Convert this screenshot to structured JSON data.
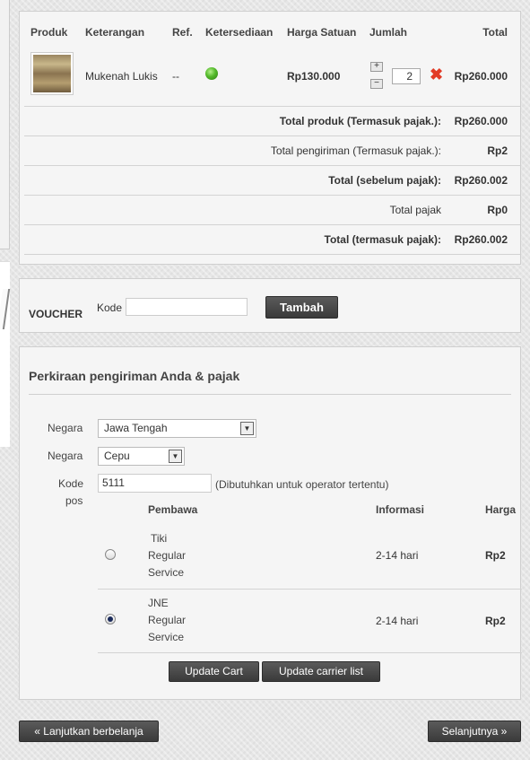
{
  "cart": {
    "headers": {
      "product": "Produk",
      "description": "Keterangan",
      "ref": "Ref.",
      "availability": "Ketersediaan",
      "unit_price": "Harga Satuan",
      "qty": "Jumlah",
      "total": "Total"
    },
    "item": {
      "name": "Mukenah Lukis",
      "ref": "--",
      "unit_price": "Rp130.000",
      "qty_increase": "+",
      "qty_decrease": "−",
      "qty": "2",
      "delete_icon": "✖",
      "total": "Rp260.000"
    },
    "summary": [
      {
        "label": "Total produk (Termasuk pajak.):",
        "value": "Rp260.000"
      },
      {
        "label": "Total pengiriman (Termasuk pajak.):",
        "value": "Rp2"
      },
      {
        "label": "Total (sebelum pajak):",
        "value": "Rp260.002"
      },
      {
        "label": "Total pajak",
        "value": "Rp0"
      },
      {
        "label": "Total (termasuk pajak):",
        "value": "Rp260.002"
      }
    ]
  },
  "voucher": {
    "title": "VOUCHER",
    "code_label": "Kode",
    "code_value": "",
    "add_button": "Tambah"
  },
  "shipping": {
    "title": "Perkiraan pengiriman Anda & pajak",
    "state_label": "Negara",
    "state_value": "Jawa Tengah",
    "city_label": "Negara",
    "city_value": "Cepu",
    "postcode_label_1": "Kode",
    "postcode_label_2": "pos",
    "postcode_value": "5111",
    "postcode_hint": "(Dibutuhkan untuk operator tertentu)",
    "carrier_headers": {
      "carrier": "Pembawa",
      "info": "Informasi",
      "price": "Harga"
    },
    "carriers": [
      {
        "line1": "Tiki",
        "line2": "Regular",
        "line3": "Service",
        "info": "2-14 hari",
        "price": "Rp2",
        "selected": false
      },
      {
        "line1": "JNE",
        "line2": "Regular",
        "line3": "Service",
        "info": "2-14 hari",
        "price": "Rp2",
        "selected": true
      }
    ],
    "update_cart": "Update Cart",
    "update_carriers": "Update carrier list"
  },
  "nav": {
    "continue_shopping": "« Lanjutkan berbelanja",
    "next": "Selanjutnya »"
  }
}
